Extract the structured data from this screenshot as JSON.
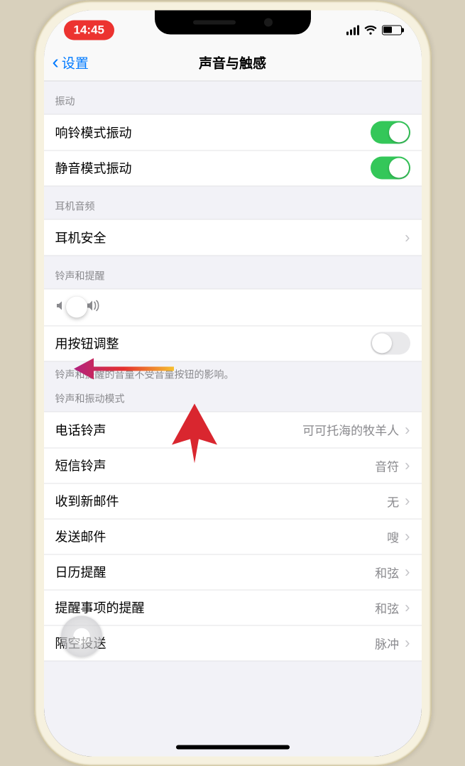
{
  "status": {
    "time": "14:45"
  },
  "nav": {
    "back": "设置",
    "title": "声音与触感"
  },
  "sections": {
    "vibrate_header": "振动",
    "ring_vibrate": "响铃模式振动",
    "silent_vibrate": "静音模式振动",
    "headphone_header": "耳机音频",
    "headphone_safety": "耳机安全",
    "ringer_header": "铃声和提醒",
    "change_with_buttons": "用按钮调整",
    "ringer_footer": "铃声和提醒的音量不受音量按钮的影响。",
    "sounds_header": "铃声和振动模式",
    "ringtone": {
      "label": "电话铃声",
      "value": "可可托海的牧羊人"
    },
    "text_tone": {
      "label": "短信铃声",
      "value": "音符"
    },
    "new_mail": {
      "label": "收到新邮件",
      "value": "无"
    },
    "sent_mail": {
      "label": "发送邮件",
      "value": "嗖"
    },
    "calendar": {
      "label": "日历提醒",
      "value": "和弦"
    },
    "reminder": {
      "label": "提醒事项的提醒",
      "value": "和弦"
    },
    "airdrop": {
      "label": "隔空投送",
      "value": "脉冲"
    }
  },
  "toggles": {
    "ring_vibrate": true,
    "silent_vibrate": true,
    "change_with_buttons": false
  },
  "slider": {
    "value_pct": 4
  }
}
